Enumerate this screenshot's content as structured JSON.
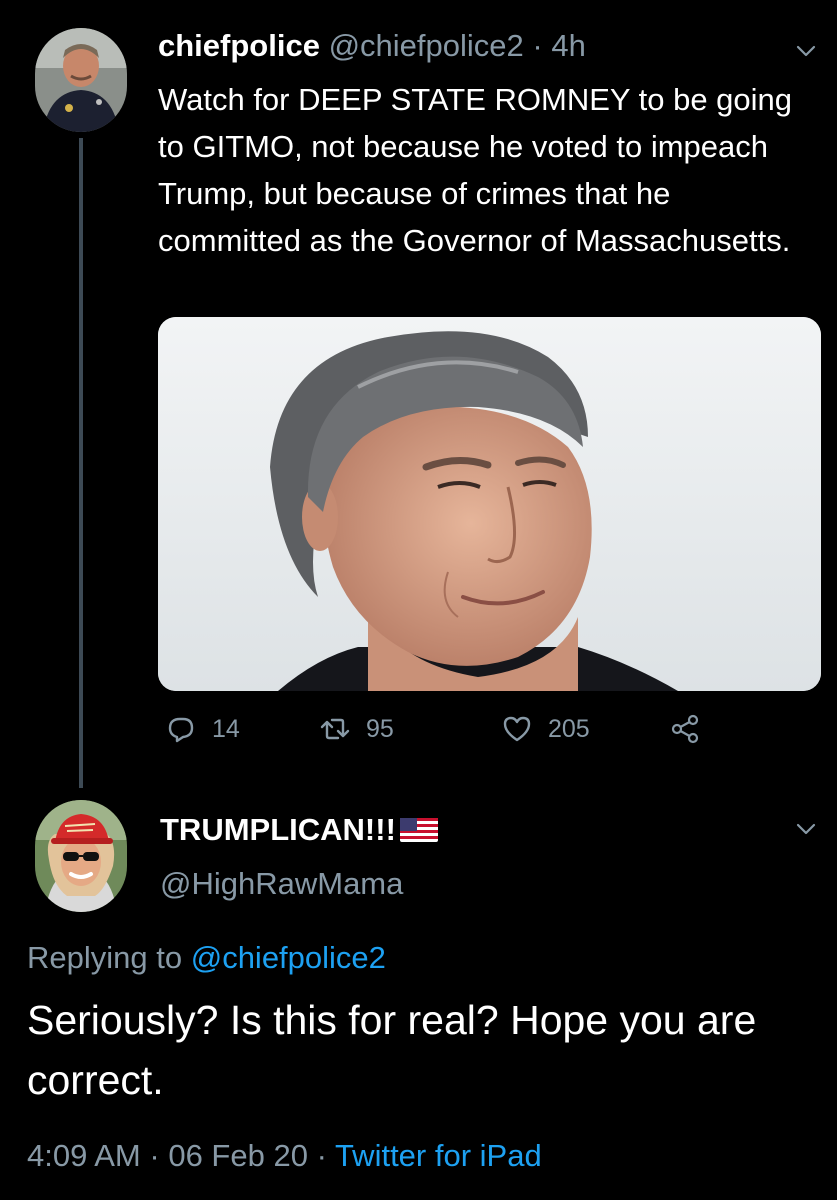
{
  "tweet": {
    "author": {
      "name": "chiefpolice",
      "handle": "@chiefpolice2",
      "separator": "·",
      "time": "4h"
    },
    "text": "Watch for DEEP STATE ROMNEY to be going to GITMO, not because he voted to impeach Trump, but because of crimes that he committed as the Governor of Massachusetts.",
    "actions": {
      "replies": "14",
      "retweets": "95",
      "likes": "205"
    }
  },
  "reply": {
    "author": {
      "name": "TRUMPLICAN!!!",
      "handle": "@HighRawMama"
    },
    "replying_prefix": "Replying to",
    "replying_to": "@chiefpolice2",
    "text": "Seriously?  Is this for real? Hope you are correct.",
    "meta": {
      "time": "4:09 AM",
      "sep1": "·",
      "date": "06 Feb 20",
      "sep2": "·",
      "source": "Twitter for iPad"
    }
  },
  "colors": {
    "background": "#000000",
    "primary_text": "#ffffff",
    "secondary_text": "#8899a6",
    "link": "#1da1f2",
    "thread_line": "#3d4a55"
  },
  "icons": [
    "chevron-down-icon",
    "reply-icon",
    "retweet-icon",
    "heart-icon",
    "share-icon",
    "us-flag-icon"
  ]
}
